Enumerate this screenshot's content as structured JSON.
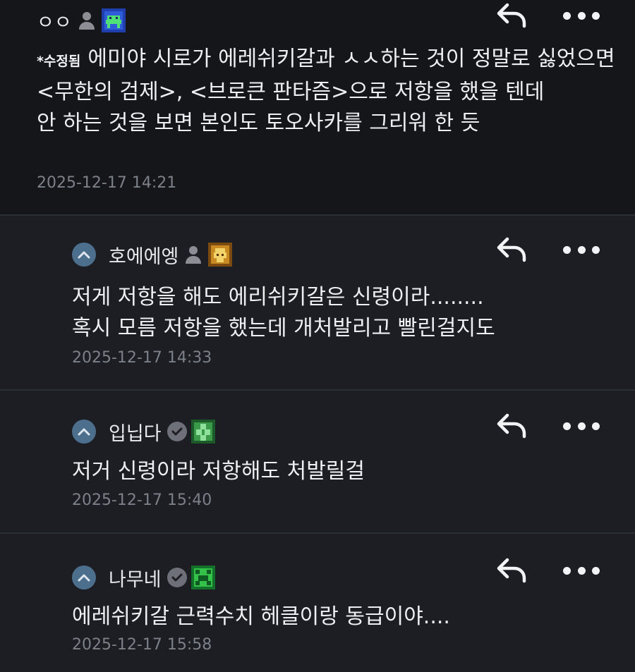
{
  "comments": [
    {
      "username": "ㅇㅇ",
      "user_icon": "person-icon",
      "badge_color": "#2f5bd8",
      "edited_tag": "*수정됨",
      "text": "에미야 시로가 에레쉬키갈과 ㅅㅅ하는 것이 정말로 싫었으면 <무한의 검제>, <브로큰 판타즘>으로 저항을 했을 텐데\n안 하는 것을 보면 본인도 토오사카를 그리워 한 듯",
      "timestamp": "2025-12-17 14:21"
    },
    {
      "username": "호에에엥",
      "user_icon": "person-icon",
      "badge_color": "#c98a22",
      "text": "저게 저항을 해도 에리쉬키갈은 신령이라........\n혹시 모름 저항을 했는데 개처발리고 빨린걸지도",
      "timestamp": "2025-12-17 14:33"
    },
    {
      "username": "입닙다",
      "user_icon": "verified-check-icon",
      "badge_color": "#3a9a4a",
      "text": "저거 신령이라 저항해도 처발릴걸",
      "timestamp": "2025-12-17 15:40"
    },
    {
      "username": "나무네",
      "user_icon": "verified-check-icon",
      "badge_color": "#36c24a",
      "text": "에레쉬키갈 근력수치 헤클이랑 동급이야....",
      "timestamp": "2025-12-17 15:58"
    }
  ],
  "colors": {
    "background": "#1b1d22",
    "top_background": "#15161a",
    "divider": "#2c3037",
    "timestamp": "#7c8089",
    "collapse_button": "#4d6f8e"
  }
}
